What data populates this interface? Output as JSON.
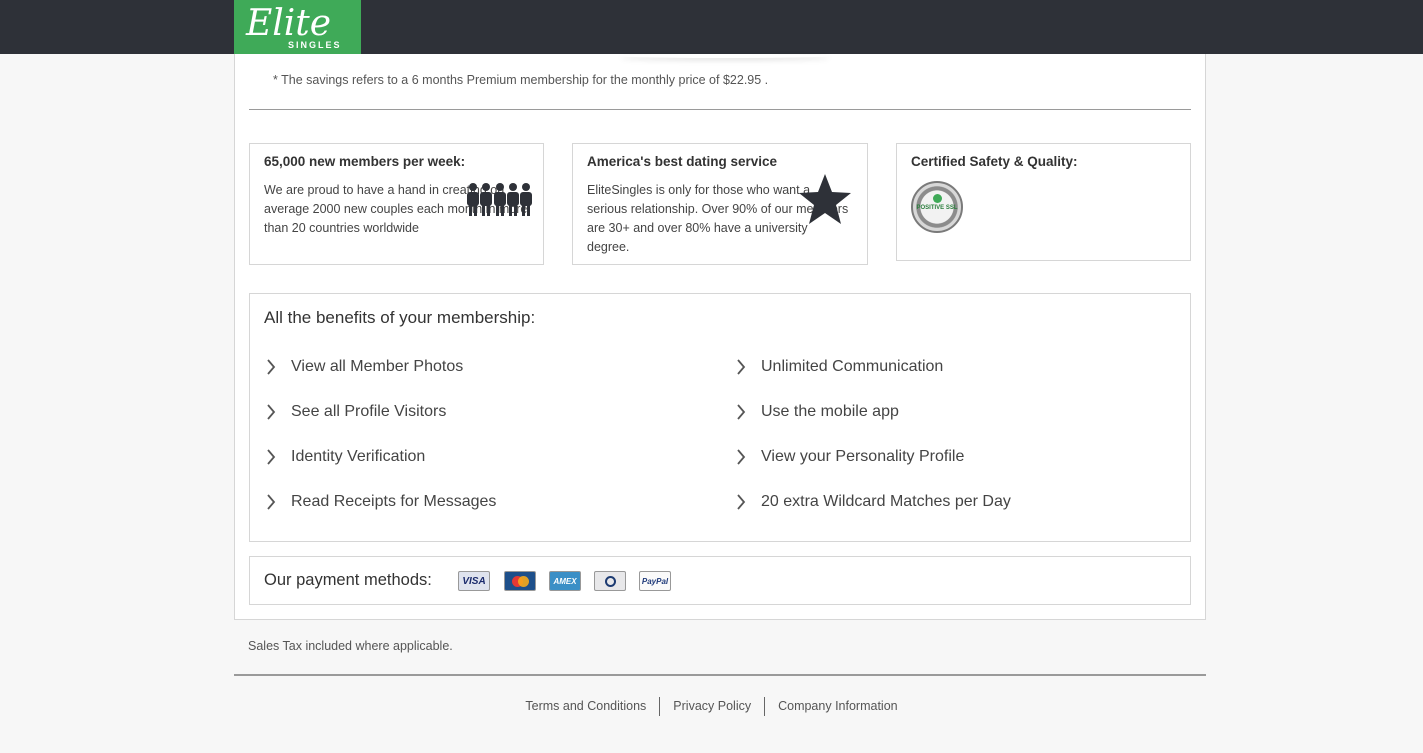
{
  "header": {
    "logo_main": "Elite",
    "logo_sub": "SINGLES"
  },
  "savings_note": "* The savings refers to a 6 months Premium membership for the monthly price of $22.95 .",
  "features": [
    {
      "title": "65,000 new members per week:",
      "text": "We are proud to have a hand in creating on average 2000 new couples each month in more than 20 countries worldwide",
      "icon": "people-icon"
    },
    {
      "title": "America's best dating service",
      "text": "EliteSingles is only for those who want a serious relationship. Over 90% of our members are 30+ and over 80% have a university degree.",
      "icon": "star-icon"
    },
    {
      "title": "Certified Safety & Quality:",
      "badge_text": "POSITIVE SSL",
      "icon": "ssl-badge-icon"
    }
  ],
  "benefits": {
    "title": "All the benefits of your membership:",
    "items": [
      "View all Member Photos",
      "Unlimited Communication",
      "See all Profile Visitors",
      "Use the mobile app",
      "Identity Verification",
      "View your Personality Profile",
      "Read Receipts for Messages",
      "20 extra Wildcard Matches per Day"
    ]
  },
  "payment": {
    "title": "Our payment methods:",
    "methods": [
      {
        "name": "visa",
        "label": "VISA"
      },
      {
        "name": "mastercard",
        "label": ""
      },
      {
        "name": "amex",
        "label": "AMEX"
      },
      {
        "name": "diners",
        "label": "Diners Club"
      },
      {
        "name": "paypal",
        "label": "PayPal"
      }
    ]
  },
  "tax_note": "Sales Tax included where applicable.",
  "footer": {
    "links": [
      "Terms and Conditions",
      "Privacy Policy",
      "Company Information"
    ]
  },
  "colors": {
    "topbar": "#2e3138",
    "brand_green": "#3faa58",
    "text": "#333333"
  }
}
